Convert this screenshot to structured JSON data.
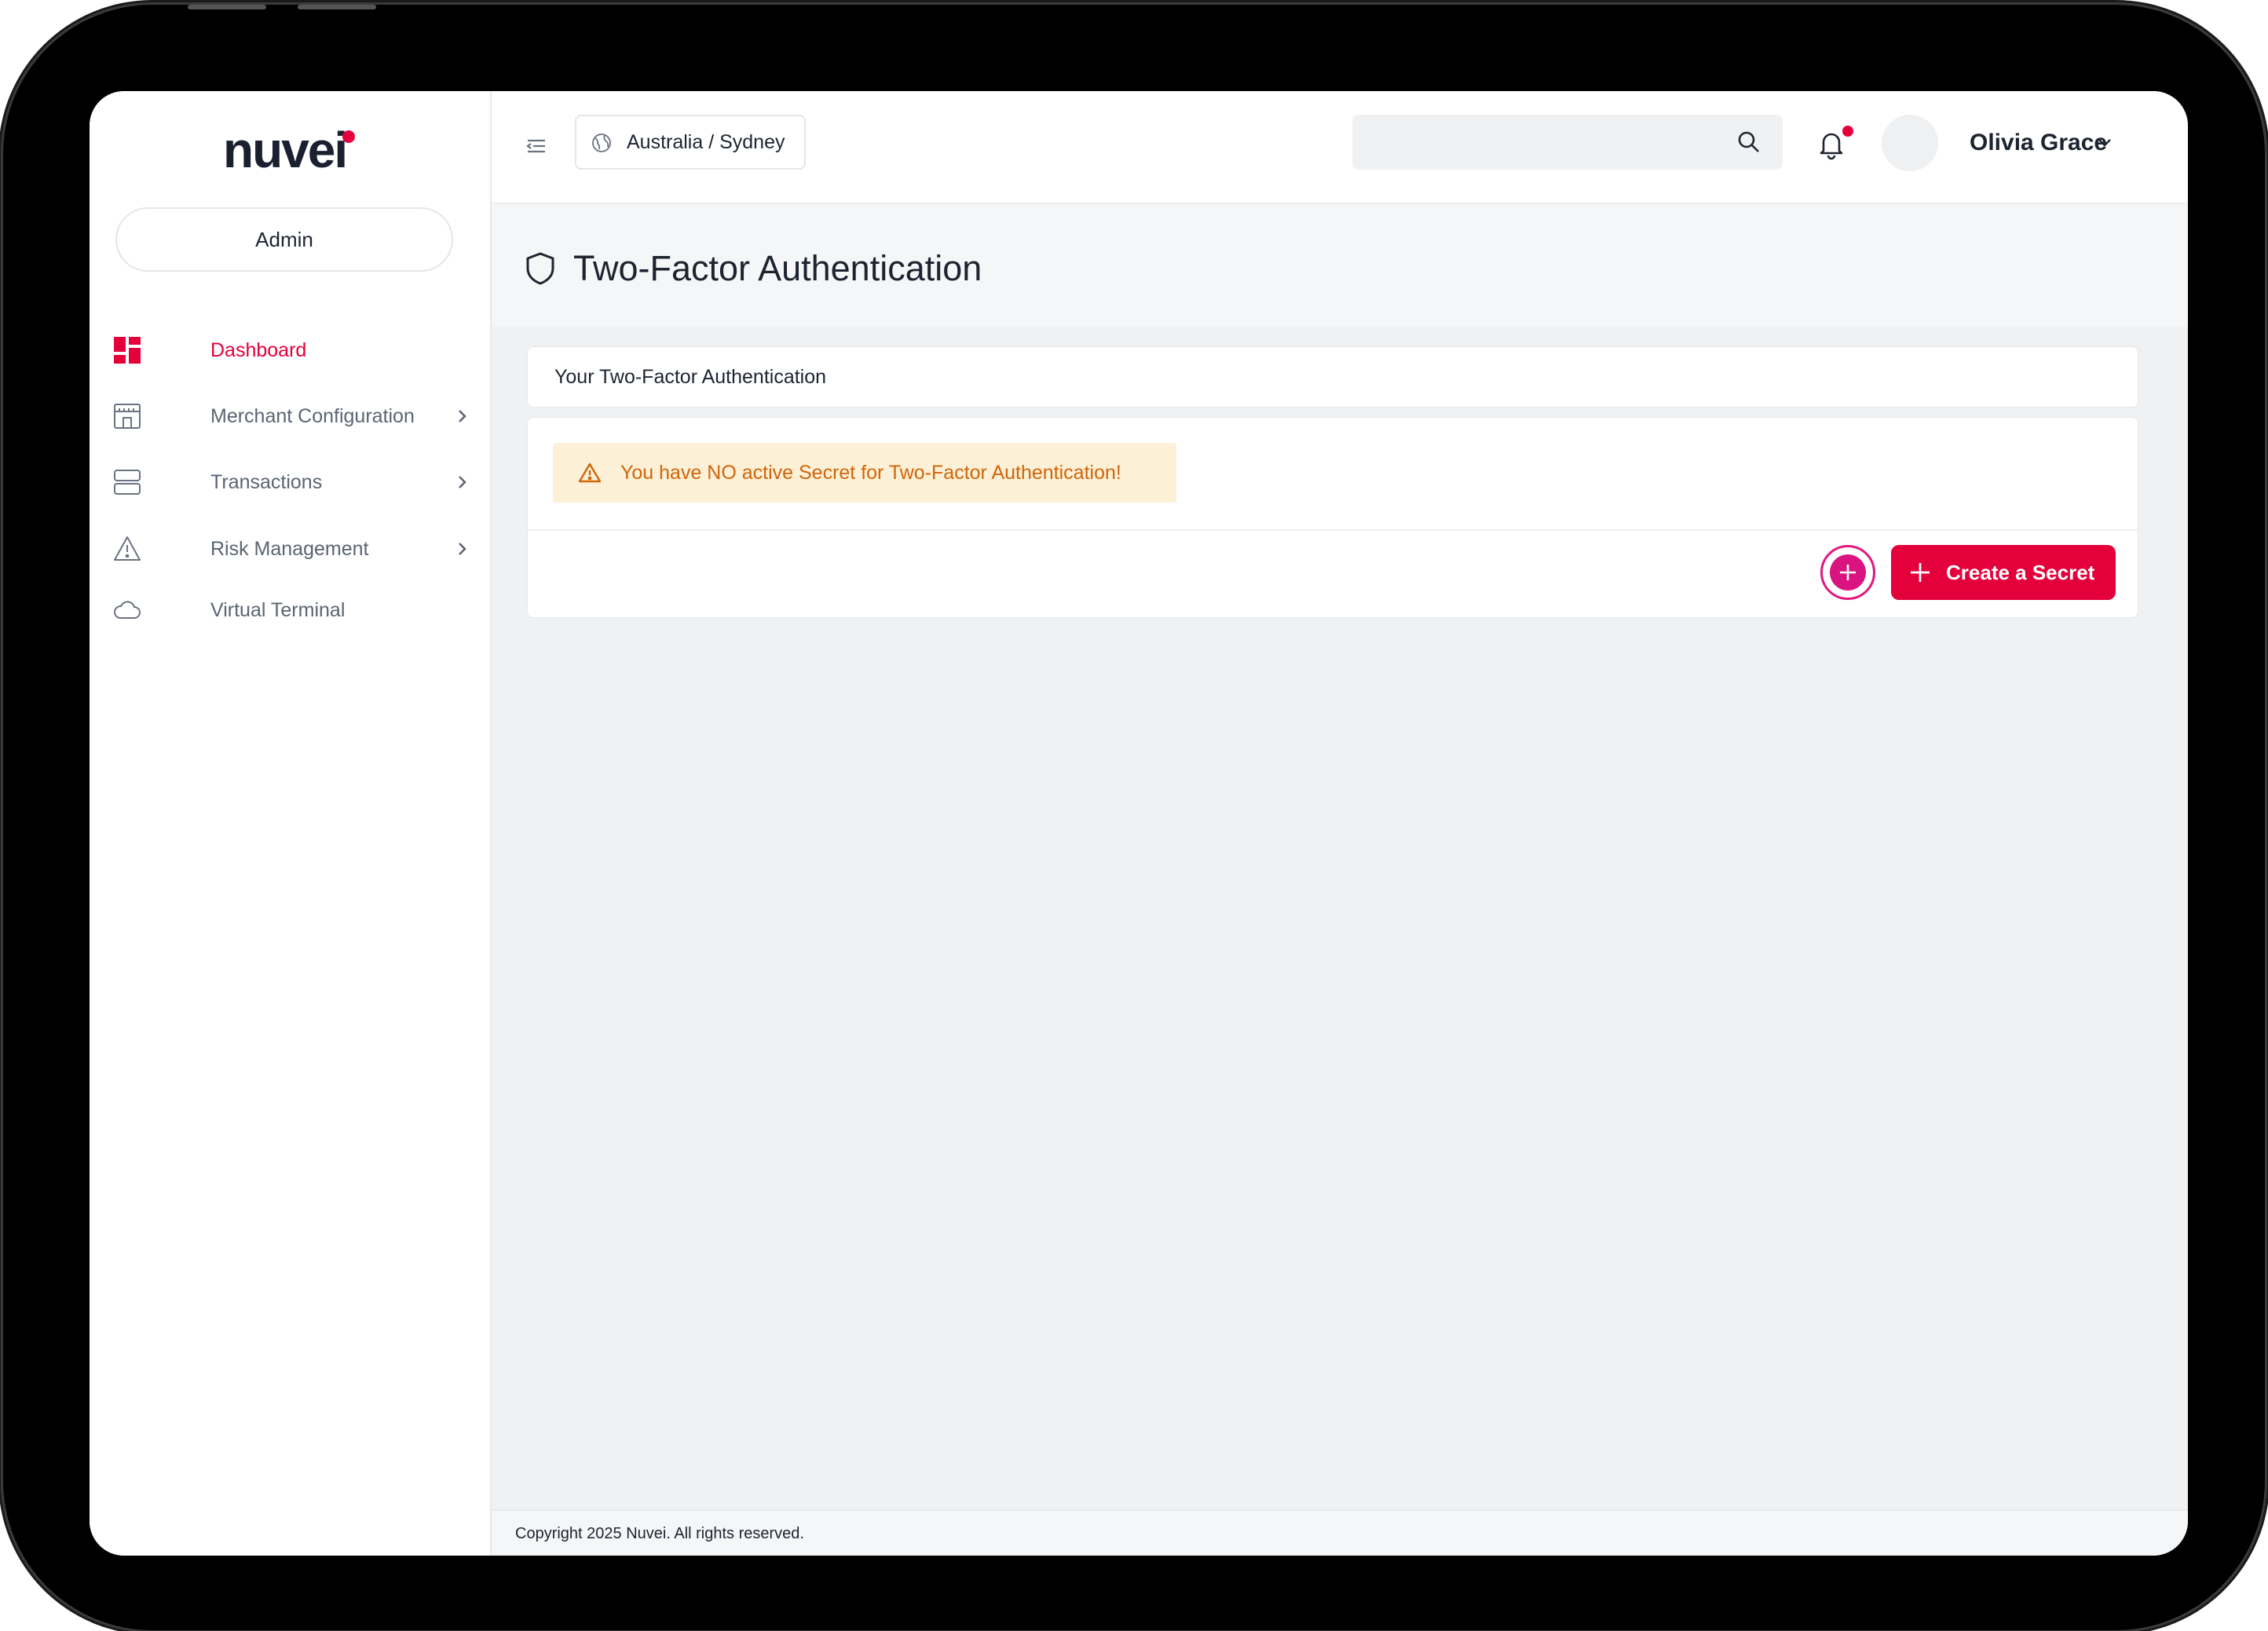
{
  "brand": {
    "logo_text": "nuvei",
    "accent": "#e4003b"
  },
  "sidebar": {
    "role": "Admin",
    "items": [
      {
        "label": "Dashboard",
        "icon": "dashboard-icon",
        "active": true,
        "has_submenu": false
      },
      {
        "label": "Merchant Configuration",
        "icon": "store-icon",
        "active": false,
        "has_submenu": true
      },
      {
        "label": "Transactions",
        "icon": "server-icon",
        "active": false,
        "has_submenu": true
      },
      {
        "label": "Risk Management",
        "icon": "warning-icon",
        "active": false,
        "has_submenu": true
      },
      {
        "label": "Virtual Terminal",
        "icon": "cloud-icon",
        "active": false,
        "has_submenu": false
      }
    ]
  },
  "header": {
    "timezone": "Australia / Sydney",
    "search": {
      "placeholder": "",
      "value": ""
    },
    "has_notification": true,
    "user_name": "Olivia Grace"
  },
  "page": {
    "title": "Two-Factor Authentication",
    "card_title": "Your Two-Factor Authentication",
    "alert": "You have NO active Secret for Two-Factor Authentication!",
    "create_button": "Create a Secret"
  },
  "footer": {
    "text": "Copyright 2025 Nuvei. All rights reserved."
  }
}
